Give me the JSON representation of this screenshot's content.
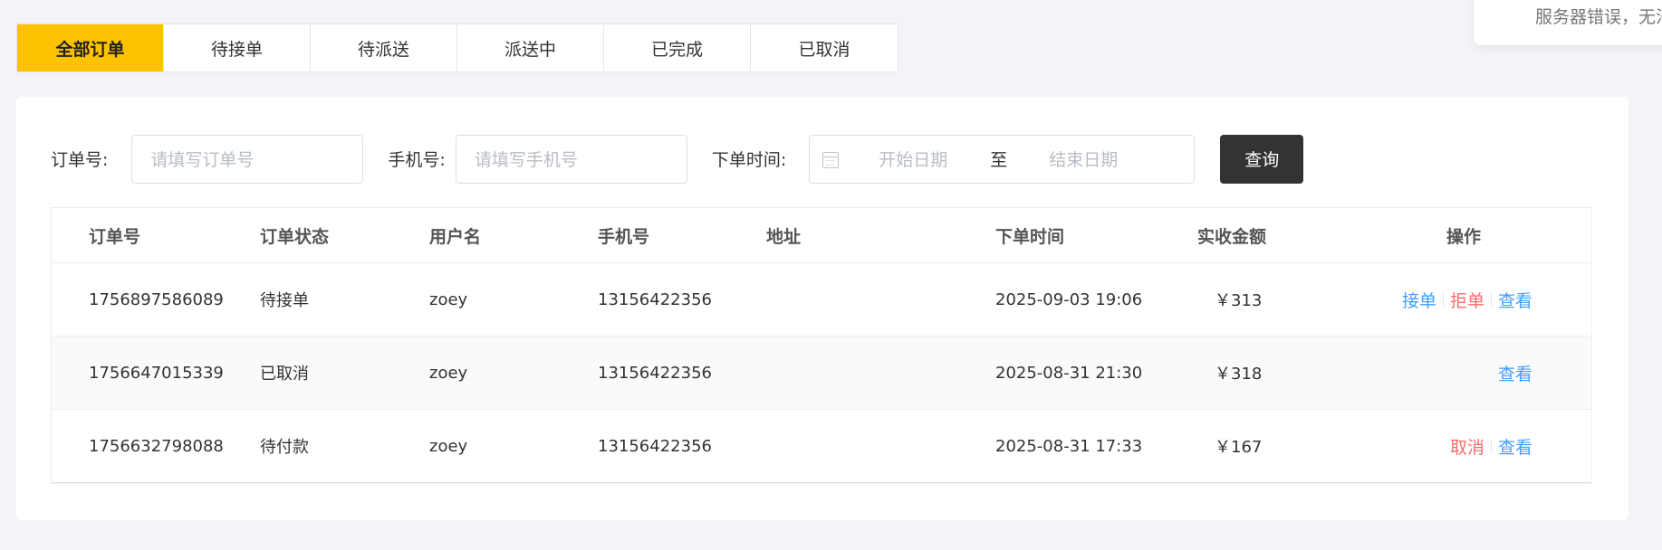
{
  "tabs": [
    "全部订单",
    "待接单",
    "待派送",
    "派送中",
    "已完成",
    "已取消"
  ],
  "toast": "服务器错误，无法",
  "filters": {
    "order_label": "订单号:",
    "order_placeholder": "请填写订单号",
    "phone_label": "手机号:",
    "phone_placeholder": "请填写手机号",
    "time_label": "下单时间:",
    "start_placeholder": "开始日期",
    "separator": "至",
    "end_placeholder": "结束日期",
    "query_button": "查询"
  },
  "table": {
    "headers": [
      "订单号",
      "订单状态",
      "用户名",
      "手机号",
      "地址",
      "下单时间",
      "实收金额",
      "操作"
    ],
    "rows": [
      {
        "order_no": "1756897586089",
        "status": "待接单",
        "user": "zoey",
        "phone": "13156422356",
        "address": "",
        "time": "2025-09-03 19:06",
        "amount": "￥313",
        "ops": [
          "接单",
          "拒单",
          "查看"
        ]
      },
      {
        "order_no": "1756647015339",
        "status": "已取消",
        "user": "zoey",
        "phone": "13156422356",
        "address": "",
        "time": "2025-08-31 21:30",
        "amount": "￥318",
        "ops": [
          "查看"
        ]
      },
      {
        "order_no": "1756632798088",
        "status": "待付款",
        "user": "zoey",
        "phone": "13156422356",
        "address": "",
        "time": "2025-08-31 17:33",
        "amount": "￥167",
        "ops": [
          "取消",
          "查看"
        ]
      }
    ]
  },
  "colors": {
    "accent": "#ffc200",
    "link_blue": "#419eff",
    "link_red": "#f56c6c",
    "button_dark": "#333333"
  }
}
